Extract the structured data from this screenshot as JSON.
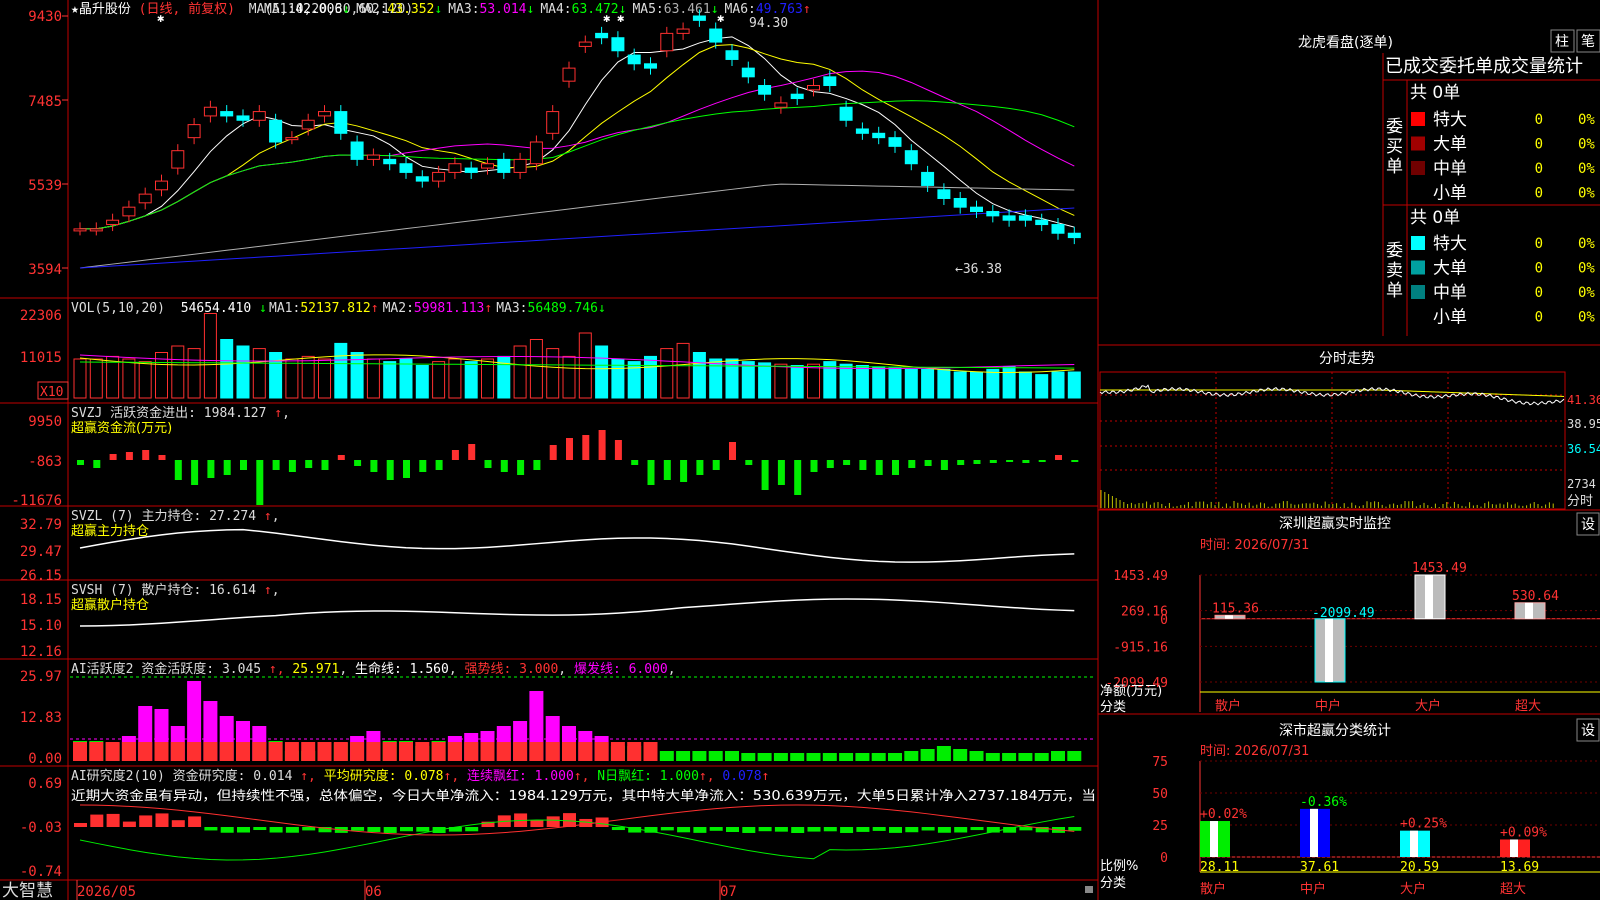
{
  "colors": {
    "up": "#ff3030",
    "down": "#00ffff",
    "ma1": "#ffffff",
    "ma2": "#ffff00",
    "ma3": "#ff00ff",
    "ma4": "#00ff00",
    "ma5": "#b0b0b0",
    "ma6": "#2020ff",
    "grid": "#c00000",
    "axis": "#ff3333",
    "green": "#00ee00",
    "yellow": "#ffff00"
  },
  "price_panel": {
    "name": "★晶升股份",
    "mode": "(日线, 前复权)",
    "ma_label": "MA(5,10,20,30,60,120)",
    "ma": [
      {
        "label": "MA1:",
        "value": "42.006",
        "arrow": "↓",
        "color": "#ffffff"
      },
      {
        "label": "MA2:",
        "value": "43.352",
        "arrow": "↓",
        "color": "#ffff00"
      },
      {
        "label": "MA3:",
        "value": "53.014",
        "arrow": "↓",
        "color": "#ff00ff"
      },
      {
        "label": "MA4:",
        "value": "63.472",
        "arrow": "↓",
        "color": "#00ff00"
      },
      {
        "label": "MA5:",
        "value": "63.461",
        "arrow": "↓",
        "color": "#b0b0b0"
      },
      {
        "label": "MA6:",
        "value": "49.763",
        "arrow": "↑",
        "color": "#2020ff"
      }
    ],
    "y_labels": [
      "9430",
      "7485",
      "5539",
      "3594"
    ],
    "high_label": "94.30",
    "low_label": "←36.38"
  },
  "vol_panel": {
    "title": "VOL(5,10,20)",
    "value": "54654.410",
    "ma": [
      {
        "label": "MA1:",
        "value": "52137.812",
        "arrow": "↑",
        "color": "#ffff00"
      },
      {
        "label": "MA2:",
        "value": "59981.113",
        "arrow": "↑",
        "color": "#ff00ff"
      },
      {
        "label": "MA3:",
        "value": "56489.746",
        "arrow": "↓",
        "color": "#00ff00"
      }
    ],
    "y_labels": [
      "22306",
      "11015"
    ],
    "unit": "X10"
  },
  "svzj_panel": {
    "title": "SVZJ  活跃资金进出: 1984.127",
    "arrow": "↑",
    "subtitle": "超赢资金流(万元)",
    "y_labels": [
      "9950",
      "-863",
      "-11676"
    ]
  },
  "svzl_panel": {
    "title": "SVZL (7) 主力持仓: 27.274",
    "arrow": "↑",
    "subtitle": "超赢主力持仓",
    "y_labels": [
      "32.79",
      "29.47",
      "26.15"
    ]
  },
  "svsh_panel": {
    "title": "SVSH (7) 散户持仓: 16.614",
    "arrow": "↑",
    "subtitle": "超赢散户持仓",
    "y_labels": [
      "18.15",
      "15.10",
      "12.16"
    ]
  },
  "ai_panel": {
    "title": "AI活跃度2 资金活跃度: 3.045",
    "v2": "25.971",
    "life": "生命线: 1.560",
    "strong": "强势线: 3.000",
    "burst": "爆发线: 6.000",
    "y_labels": [
      "25.97",
      "12.83",
      "0.00"
    ]
  },
  "research_panel": {
    "title": "AI研究度2(10) 资金研究度: 0.014",
    "avg": "平均研究度: 0.078",
    "cont": "连续飘红: 1.000",
    "n": "N日飘红: 1.000",
    "last": "0.078",
    "text": "近期大资金虽有异动，但持续性不强，总体偏空，今日大单净流入：1984.129万元，其中特大单净流入：530.639万元，大单5日累计净入2737.184万元，当",
    "y_labels": [
      "0.69",
      "-0.03",
      "-0.74"
    ]
  },
  "bottom_bar": {
    "brand": "大智慧",
    "dates": [
      "2026/05",
      "06",
      "07"
    ]
  },
  "dragon": {
    "title": "龙虎看盘(逐单)",
    "btn_bar": "柱",
    "btn_pen": "笔",
    "header": "已成交委托单成交量统计",
    "buy_label": "委买单",
    "sell_label": "委卖单",
    "buy_total": "共 0单",
    "sell_total": "共 0单",
    "rows": [
      {
        "name": "特大",
        "count": "0",
        "pct": "0%",
        "buy_color": "#ff0000",
        "sell_color": "#00ffff"
      },
      {
        "name": "大单",
        "count": "0",
        "pct": "0%",
        "buy_color": "#a00000",
        "sell_color": "#00a0a0"
      },
      {
        "name": "中单",
        "count": "0",
        "pct": "0%",
        "buy_color": "#700000",
        "sell_color": "#008080"
      },
      {
        "name": "小单",
        "count": "0",
        "pct": "0%",
        "buy_color": "",
        "sell_color": ""
      }
    ]
  },
  "intraday": {
    "title": "分时走势",
    "prices": [
      "41.36",
      "38.95",
      "36.54"
    ],
    "vol_label": "2734",
    "vol_sub": "分时"
  },
  "sz_monitor": {
    "title": "深圳超赢实时监控",
    "btn": "设",
    "time": "时间: 2026/07/31",
    "y_labels": [
      "1453.49",
      "269.16",
      "0",
      "-915.16",
      "-2099.49"
    ],
    "ylabel": "净额(万元)",
    "xlabel": "分类",
    "chart_data": {
      "type": "bar",
      "categories": [
        "散户",
        "中户",
        "大户",
        "超大"
      ],
      "values": [
        115.36,
        -2099.49,
        1453.49,
        530.64
      ],
      "value_labels": [
        "115.36",
        "-2099.49",
        "1453.49",
        "530.64"
      ],
      "ylim": [
        -2099.49,
        1453.49
      ],
      "ylabel": "净额(万元)",
      "xlabel": "分类"
    }
  },
  "sz_class": {
    "title": "深市超赢分类统计",
    "btn": "设",
    "time": "时间: 2026/07/31",
    "y_labels": [
      "75",
      "50",
      "25",
      "0"
    ],
    "ylabel": "比例%",
    "xlabel": "分类",
    "chart_data": {
      "type": "bar",
      "categories": [
        "散户",
        "中户",
        "大户",
        "超大"
      ],
      "values": [
        28.11,
        37.61,
        20.59,
        13.69
      ],
      "changes": [
        "+0.02%",
        "-0.36%",
        "+0.25%",
        "+0.09%"
      ],
      "value_labels": [
        "28.11",
        "37.61",
        "20.59",
        "13.69"
      ],
      "ylim": [
        0,
        75
      ],
      "ylabel": "比例%",
      "xlabel": "分类"
    }
  }
}
